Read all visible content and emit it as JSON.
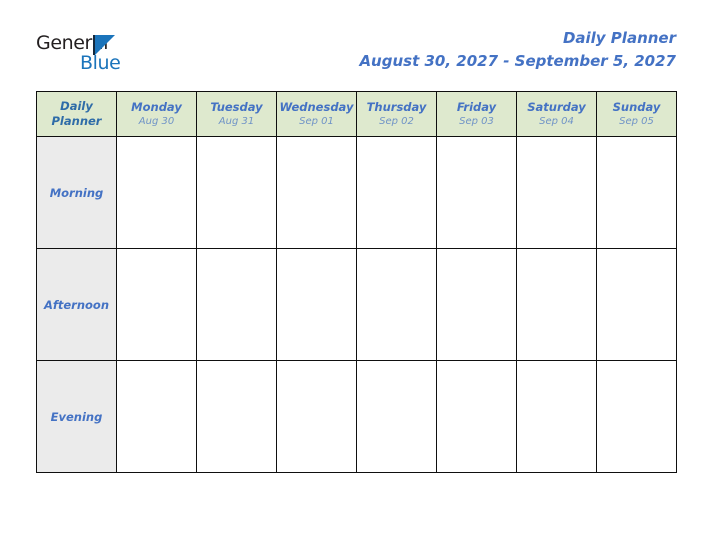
{
  "brand": {
    "word_dark": "General",
    "word_blue": "Blue",
    "triangle_color": "#1b74bb",
    "dark_color": "#231f20",
    "blue_color": "#1b74bb"
  },
  "header": {
    "title": "Daily Planner",
    "date_range": "August 30, 2027 - September 5, 2027",
    "title_color": "#4472c4"
  },
  "planner": {
    "corner": {
      "line1": "Daily",
      "line2": "Planner"
    },
    "header_bg": "#dee9ce",
    "row_label_bg": "#ebebeb",
    "cell_bg": "#ffffff",
    "border_color": "#0f0f0f",
    "days": [
      {
        "name": "Monday",
        "date": "Aug 30"
      },
      {
        "name": "Tuesday",
        "date": "Aug 31"
      },
      {
        "name": "Wednesday",
        "date": "Sep 01"
      },
      {
        "name": "Thursday",
        "date": "Sep 02"
      },
      {
        "name": "Friday",
        "date": "Sep 03"
      },
      {
        "name": "Saturday",
        "date": "Sep 04"
      },
      {
        "name": "Sunday",
        "date": "Sep 05"
      }
    ],
    "rows": [
      {
        "label": "Morning",
        "entries": [
          "",
          "",
          "",
          "",
          "",
          "",
          ""
        ]
      },
      {
        "label": "Afternoon",
        "entries": [
          "",
          "",
          "",
          "",
          "",
          "",
          ""
        ]
      },
      {
        "label": "Evening",
        "entries": [
          "",
          "",
          "",
          "",
          "",
          "",
          ""
        ]
      }
    ]
  }
}
